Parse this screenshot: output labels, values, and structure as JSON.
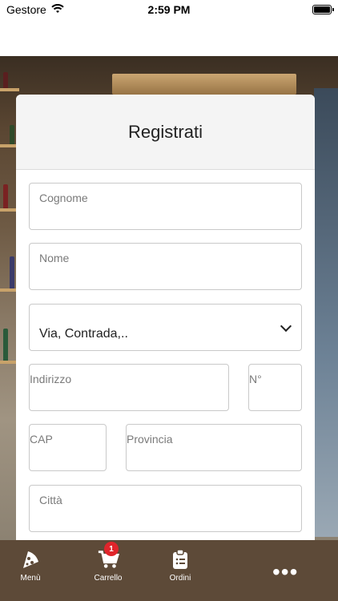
{
  "status": {
    "carrier": "Gestore",
    "time": "2:59 PM"
  },
  "form": {
    "title": "Registrati",
    "cognome_placeholder": "Cognome",
    "nome_placeholder": "Nome",
    "street_type_value": "Via, Contrada,..",
    "indirizzo_placeholder": "Indirizzo",
    "numero_placeholder": "N°",
    "cap_placeholder": "CAP",
    "provincia_placeholder": "Provincia",
    "citta_placeholder": "Città"
  },
  "tabbar": {
    "menu_label": "Menù",
    "carrello_label": "Carrello",
    "carrello_badge": "1",
    "ordini_label": "Ordini",
    "more_label": "•••"
  },
  "icons": [
    "wifi-icon",
    "battery-icon",
    "pizza-icon",
    "cart-icon",
    "clipboard-icon",
    "more-icon",
    "chevron-down-icon"
  ],
  "colors": {
    "tabbar": "#5d4a38",
    "badge": "#e0252b"
  }
}
